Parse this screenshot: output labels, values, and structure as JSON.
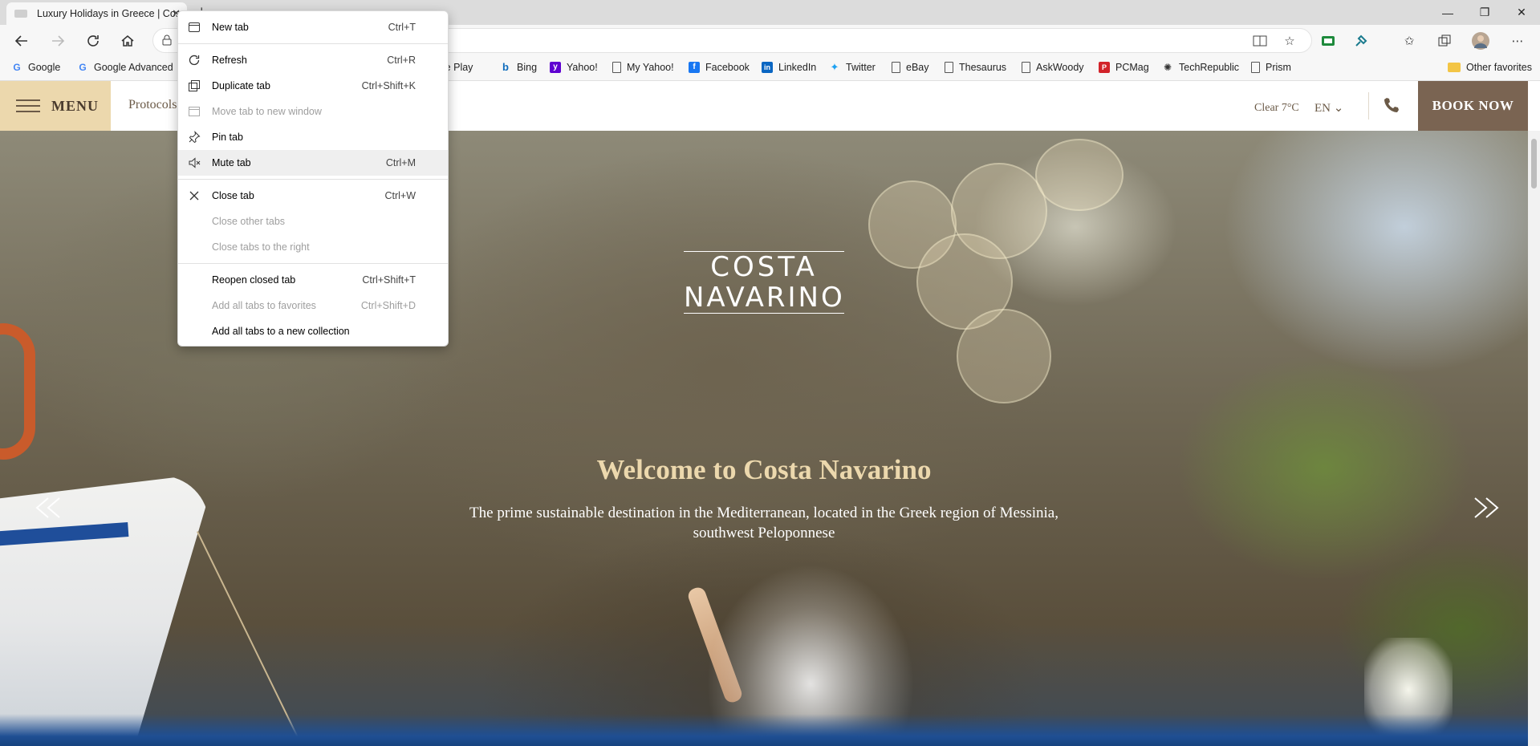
{
  "browser": {
    "tab_title": "Luxury Holidays in Greece | Costa Navarino",
    "bookmarks": [
      {
        "label": "Google",
        "icon": "google-icon"
      },
      {
        "label": "Google Advanced",
        "icon": "google-icon"
      },
      {
        "label": "ogle Play",
        "icon": "page-icon"
      },
      {
        "label": "Bing",
        "icon": "bing-icon"
      },
      {
        "label": "Yahoo!",
        "icon": "yahoo-icon"
      },
      {
        "label": "My Yahoo!",
        "icon": "page-icon"
      },
      {
        "label": "Facebook",
        "icon": "facebook-icon"
      },
      {
        "label": "LinkedIn",
        "icon": "linkedin-icon"
      },
      {
        "label": "Twitter",
        "icon": "twitter-icon"
      },
      {
        "label": "eBay",
        "icon": "page-icon"
      },
      {
        "label": "Thesaurus",
        "icon": "page-icon"
      },
      {
        "label": "AskWoody",
        "icon": "page-icon"
      },
      {
        "label": "PCMag",
        "icon": "pcmag-icon"
      },
      {
        "label": "TechRepublic",
        "icon": "techrepublic-icon"
      },
      {
        "label": "Prism",
        "icon": "page-icon"
      }
    ],
    "other_favorites": "Other favorites"
  },
  "site": {
    "menu_label": "MENU",
    "protocols": "Protocols",
    "weather": "Clear 7°C",
    "lang": "EN",
    "book_now": "BOOK NOW",
    "logo_line1": "COSTA",
    "logo_line2": "NAVARINO",
    "welcome": "Welcome to Costa Navarino",
    "tagline": "The prime sustainable destination in the Mediterranean, located in the Greek region of Messinia, southwest Peloponnese"
  },
  "context_menu": {
    "items": [
      {
        "label": "New tab",
        "shortcut": "Ctrl+T",
        "disabled": false
      },
      {
        "label": "Refresh",
        "shortcut": "Ctrl+R",
        "disabled": false
      },
      {
        "label": "Duplicate tab",
        "shortcut": "Ctrl+Shift+K",
        "disabled": false
      },
      {
        "label": "Move tab to new window",
        "shortcut": "",
        "disabled": true
      },
      {
        "label": "Pin tab",
        "shortcut": "",
        "disabled": false
      },
      {
        "label": "Mute tab",
        "shortcut": "Ctrl+M",
        "disabled": false
      },
      {
        "label": "Close tab",
        "shortcut": "Ctrl+W",
        "disabled": false
      },
      {
        "label": "Close other tabs",
        "shortcut": "",
        "disabled": true
      },
      {
        "label": "Close tabs to the right",
        "shortcut": "",
        "disabled": true
      },
      {
        "label": "Reopen closed tab",
        "shortcut": "Ctrl+Shift+T",
        "disabled": false
      },
      {
        "label": "Add all tabs to favorites",
        "shortcut": "Ctrl+Shift+D",
        "disabled": true
      },
      {
        "label": "Add all tabs to a new collection",
        "shortcut": "",
        "disabled": false
      }
    ]
  },
  "colors": {
    "menu_block": "#ecd8ad",
    "book_now": "#7a6452",
    "welcome_text": "#ecd8ad"
  }
}
